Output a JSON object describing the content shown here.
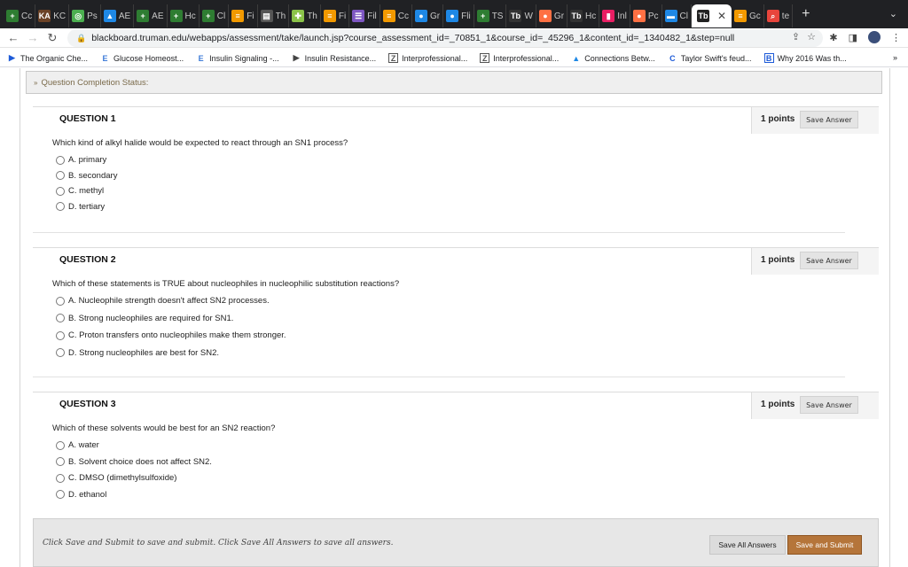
{
  "tabs": [
    {
      "label": "Cc",
      "icon": "plus-icon",
      "color": "#2e7d32"
    },
    {
      "label": "KC",
      "icon": "khan-icon",
      "color": "#6b4226"
    },
    {
      "label": "Ps",
      "icon": "globe-icon",
      "color": "#4caf50"
    },
    {
      "label": "AE",
      "icon": "drive-icon",
      "color": "#1e88e5"
    },
    {
      "label": "AE",
      "icon": "plus-icon",
      "color": "#2e7d32"
    },
    {
      "label": "Hc",
      "icon": "plus-icon",
      "color": "#2e7d32"
    },
    {
      "label": "Cl",
      "icon": "plus-icon",
      "color": "#2e7d32"
    },
    {
      "label": "Fi",
      "icon": "doc-icon",
      "color": "#f29900"
    },
    {
      "label": "Th",
      "icon": "slides-icon",
      "color": "#555"
    },
    {
      "label": "Th",
      "icon": "puzzle-icon",
      "color": "#8bc34a"
    },
    {
      "label": "Fi",
      "icon": "doc-icon",
      "color": "#f29900"
    },
    {
      "label": "Fil",
      "icon": "form-icon",
      "color": "#7e57c2"
    },
    {
      "label": "Cc",
      "icon": "doc-icon",
      "color": "#f29900"
    },
    {
      "label": "Gr",
      "icon": "chat-icon",
      "color": "#1e88e5"
    },
    {
      "label": "Fli",
      "icon": "chat-icon",
      "color": "#1e88e5"
    },
    {
      "label": "TS",
      "icon": "plus-icon",
      "color": "#2e7d32"
    },
    {
      "label": "W",
      "icon": "tb-icon",
      "color": "#333"
    },
    {
      "label": "Gr",
      "icon": "circle-icon",
      "color": "#ff7043"
    },
    {
      "label": "Hc",
      "icon": "tb-icon",
      "color": "#333"
    },
    {
      "label": "Inl",
      "icon": "chart-icon",
      "color": "#e91e63"
    },
    {
      "label": "Pc",
      "icon": "circle-icon",
      "color": "#ff7043"
    },
    {
      "label": "Cl",
      "icon": "mail-icon",
      "color": "#1e88e5"
    }
  ],
  "active_tab": {
    "label": "Tb",
    "icon": "tb-icon"
  },
  "tabs_after": [
    {
      "label": "Gc",
      "icon": "doc-icon",
      "color": "#f29900"
    },
    {
      "label": "te",
      "icon": "search-icon",
      "color": "#e8453c"
    }
  ],
  "url": "blackboard.truman.edu/webapps/assessment/take/launch.jsp?course_assessment_id=_70851_1&course_id=_45296_1&content_id=_1340482_1&step=null",
  "bookmarks": [
    {
      "label": "The Organic Che...",
      "icon": "yt-icon",
      "color": "#1e5bd8"
    },
    {
      "label": "Glucose Homeost...",
      "icon": "e-icon",
      "color": "#3d7bd8"
    },
    {
      "label": "Insulin Signaling -...",
      "icon": "e-icon",
      "color": "#3d7bd8"
    },
    {
      "label": "Insulin Resistance...",
      "icon": "play-icon",
      "color": "#444"
    },
    {
      "label": "Interprofessional...",
      "icon": "z-icon",
      "color": "#555"
    },
    {
      "label": "Interprofessional...",
      "icon": "z-icon",
      "color": "#555"
    },
    {
      "label": "Connections Betw...",
      "icon": "drive-icon",
      "color": "#1e88e5"
    },
    {
      "label": "Taylor Swift's feud...",
      "icon": "c-icon",
      "color": "#1e5bd8"
    },
    {
      "label": "Why 2016 Was th...",
      "icon": "b-icon",
      "color": "#1e5bd8"
    }
  ],
  "bookmarks_more": "»",
  "status_label": "Question Completion Status:",
  "questions": [
    {
      "title": "QUESTION 1",
      "points": "1 points",
      "save": "Save Answer",
      "text": "Which kind of alkyl halide would be expected to react through an SN1 process?",
      "options": [
        "A. primary",
        "B. secondary",
        "C. methyl",
        "D. tertiary"
      ]
    },
    {
      "title": "QUESTION 2",
      "points": "1 points",
      "save": "Save Answer",
      "text": "Which of these statements is TRUE about nucleophiles in nucleophilic substitution reactions?",
      "options": [
        "A. Nucleophile strength doesn't affect SN2 processes.",
        "B. Strong nucleophiles are required for SN1.",
        "C. Proton transfers onto nucleophiles make them stronger.",
        "D. Strong nucleophiles are best for SN2."
      ]
    },
    {
      "title": "QUESTION 3",
      "points": "1 points",
      "save": "Save Answer",
      "text": "Which of these solvents would be best for an SN2 reaction?",
      "options": [
        "A. water",
        "B. Solvent choice does not affect SN2.",
        "C. DMSO (dimethylsulfoxide)",
        "D. ethanol"
      ]
    }
  ],
  "footer": {
    "instructions": "Click Save and Submit to save and submit. Click Save All Answers to save all answers.",
    "save_all": "Save All Answers",
    "submit": "Save and Submit"
  },
  "colors": {
    "submit": "#b5753a",
    "status_text": "#7a6a4a"
  }
}
